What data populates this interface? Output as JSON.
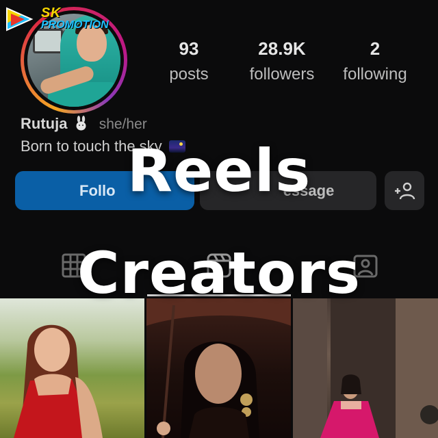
{
  "logo": {
    "line1": "SK",
    "line2": "PROMOTION"
  },
  "profile": {
    "stats": [
      {
        "value": "93",
        "label": "posts"
      },
      {
        "value": "28.9K",
        "label": "followers"
      },
      {
        "value": "2",
        "label": "following"
      }
    ],
    "name": "Rutuja",
    "pronouns": "she/her",
    "bio": "Born to touch the sky",
    "buttons": {
      "follow": "Follo",
      "message": "essage"
    }
  },
  "overlay": {
    "line1": "Reels",
    "line2": "Creators"
  },
  "colors": {
    "follow_button": "#0a5fa6",
    "accent_yellow": "#f5d400",
    "accent_blue": "#1ec0ff",
    "background": "#0b0b0c"
  },
  "icons": [
    "grid-icon",
    "reels-icon",
    "tagged-icon",
    "add-person-icon"
  ]
}
